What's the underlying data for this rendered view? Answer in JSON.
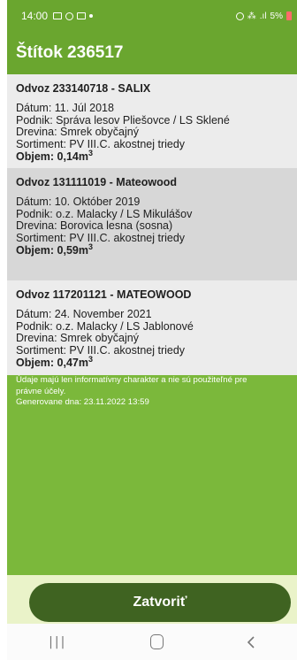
{
  "status_bar": {
    "time": "14:00",
    "battery": "5%",
    "left_icons": [
      "gallery-icon",
      "instagram-icon",
      "messenger-icon",
      "notification-dot-icon"
    ],
    "right_icons": [
      "alarm-icon",
      "volte-icon",
      "signal-icon",
      "battery-low-icon"
    ],
    "colors": {
      "bar": "#6aa62f",
      "battery": "#ff6b6b"
    }
  },
  "app_bar": {
    "title": "Štítok 236517",
    "color": "#6aa62f"
  },
  "records": [
    {
      "title": "Odvoz 233140718 - SALIX",
      "date": "Dátum: 11. Júl 2018",
      "company": "Podnik: Správa lesov Pliešovce / LS Sklené",
      "species": "Drevina: Smrek obyčajný",
      "assortment": "Sortiment: PV III.C. akostnej triedy",
      "volume_label": "Objem: 0,14m",
      "volume_sup": "3"
    },
    {
      "title": "Odvoz 131111019 - Mateowood",
      "date": "Dátum: 10. Október 2019",
      "company": "Podnik: o.z. Malacky / LS Mikulášov",
      "species": "Drevina: Borovica lesna (sosna)",
      "assortment": "Sortiment: PV III.C. akostnej triedy",
      "volume_label": "Objem: 0,59m",
      "volume_sup": "3"
    },
    {
      "title": "Odvoz 117201121 - MATEOWOOD",
      "date": "Dátum: 24. November 2021",
      "company": "Podnik: o.z. Malacky / LS Jablonové",
      "species": "Drevina: Smrek obyčajný",
      "assortment": "Sortiment: PV III.C. akostnej triedy",
      "volume_label": "Objem: 0,47m",
      "volume_sup": "3"
    }
  ],
  "disclaimer": {
    "line1": "Údaje majú len informatívny charakter a nie sú použiteľné pre",
    "line2": "právne účely.",
    "generated": "Generovane dna: 23.11.2022 13:59"
  },
  "close_button": {
    "label": "Zatvoriť",
    "color": "#3f6321"
  },
  "nav_bar": {
    "icons": [
      "recents-icon",
      "home-icon",
      "back-icon"
    ]
  },
  "colors": {
    "background": "#7bb83b",
    "bottom_panel": "#eaf3c9"
  }
}
